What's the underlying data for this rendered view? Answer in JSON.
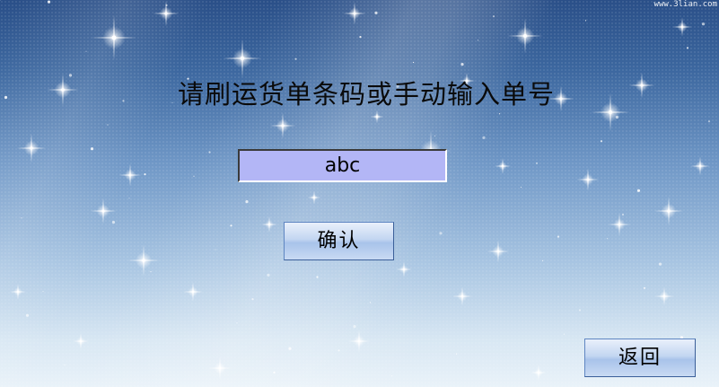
{
  "background": {
    "watermark": "www.3lian.com",
    "colors": {
      "sky_top": "#2a4f88",
      "sky_bottom": "#e9f2f9"
    }
  },
  "prompt": {
    "text": "请刷运货单条码或手动输入单号"
  },
  "barcode_input": {
    "value": "abc",
    "background_color": "#b3b6f6"
  },
  "buttons": {
    "confirm_label": "确认",
    "back_label": "返回"
  }
}
